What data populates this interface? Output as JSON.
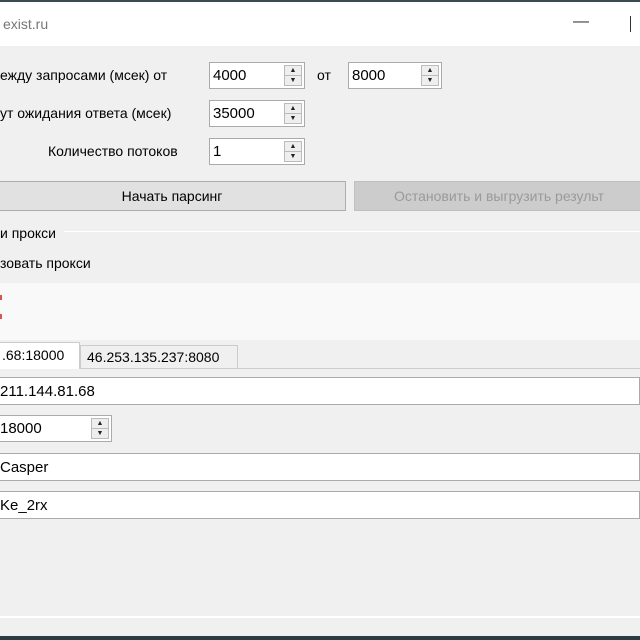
{
  "window": {
    "title": "exist.ru",
    "minimize": "—"
  },
  "settings": {
    "delay_label": "ежду запросами (мсек) от",
    "delay_from": "4000",
    "delay_to_label": "от",
    "delay_to": "8000",
    "timeout_label": "ут ожидания ответа (мсек)",
    "timeout": "35000",
    "threads_label": "Количество потоков",
    "threads": "1"
  },
  "buttons": {
    "start": "Начать парсинг",
    "stop": "Остановить и выгрузить результ"
  },
  "proxy": {
    "group_label": "и прокси",
    "use_label": "зовать прокси",
    "tabs": [
      {
        "label": ".68:18000",
        "selected": true
      },
      {
        "label": "46.253.135.237:8080",
        "selected": false
      }
    ],
    "host": "211.144.81.68",
    "port": "18000",
    "login": "Casper",
    "password": "Ke_2rx"
  },
  "colors": {
    "accent": "#d9534f"
  }
}
